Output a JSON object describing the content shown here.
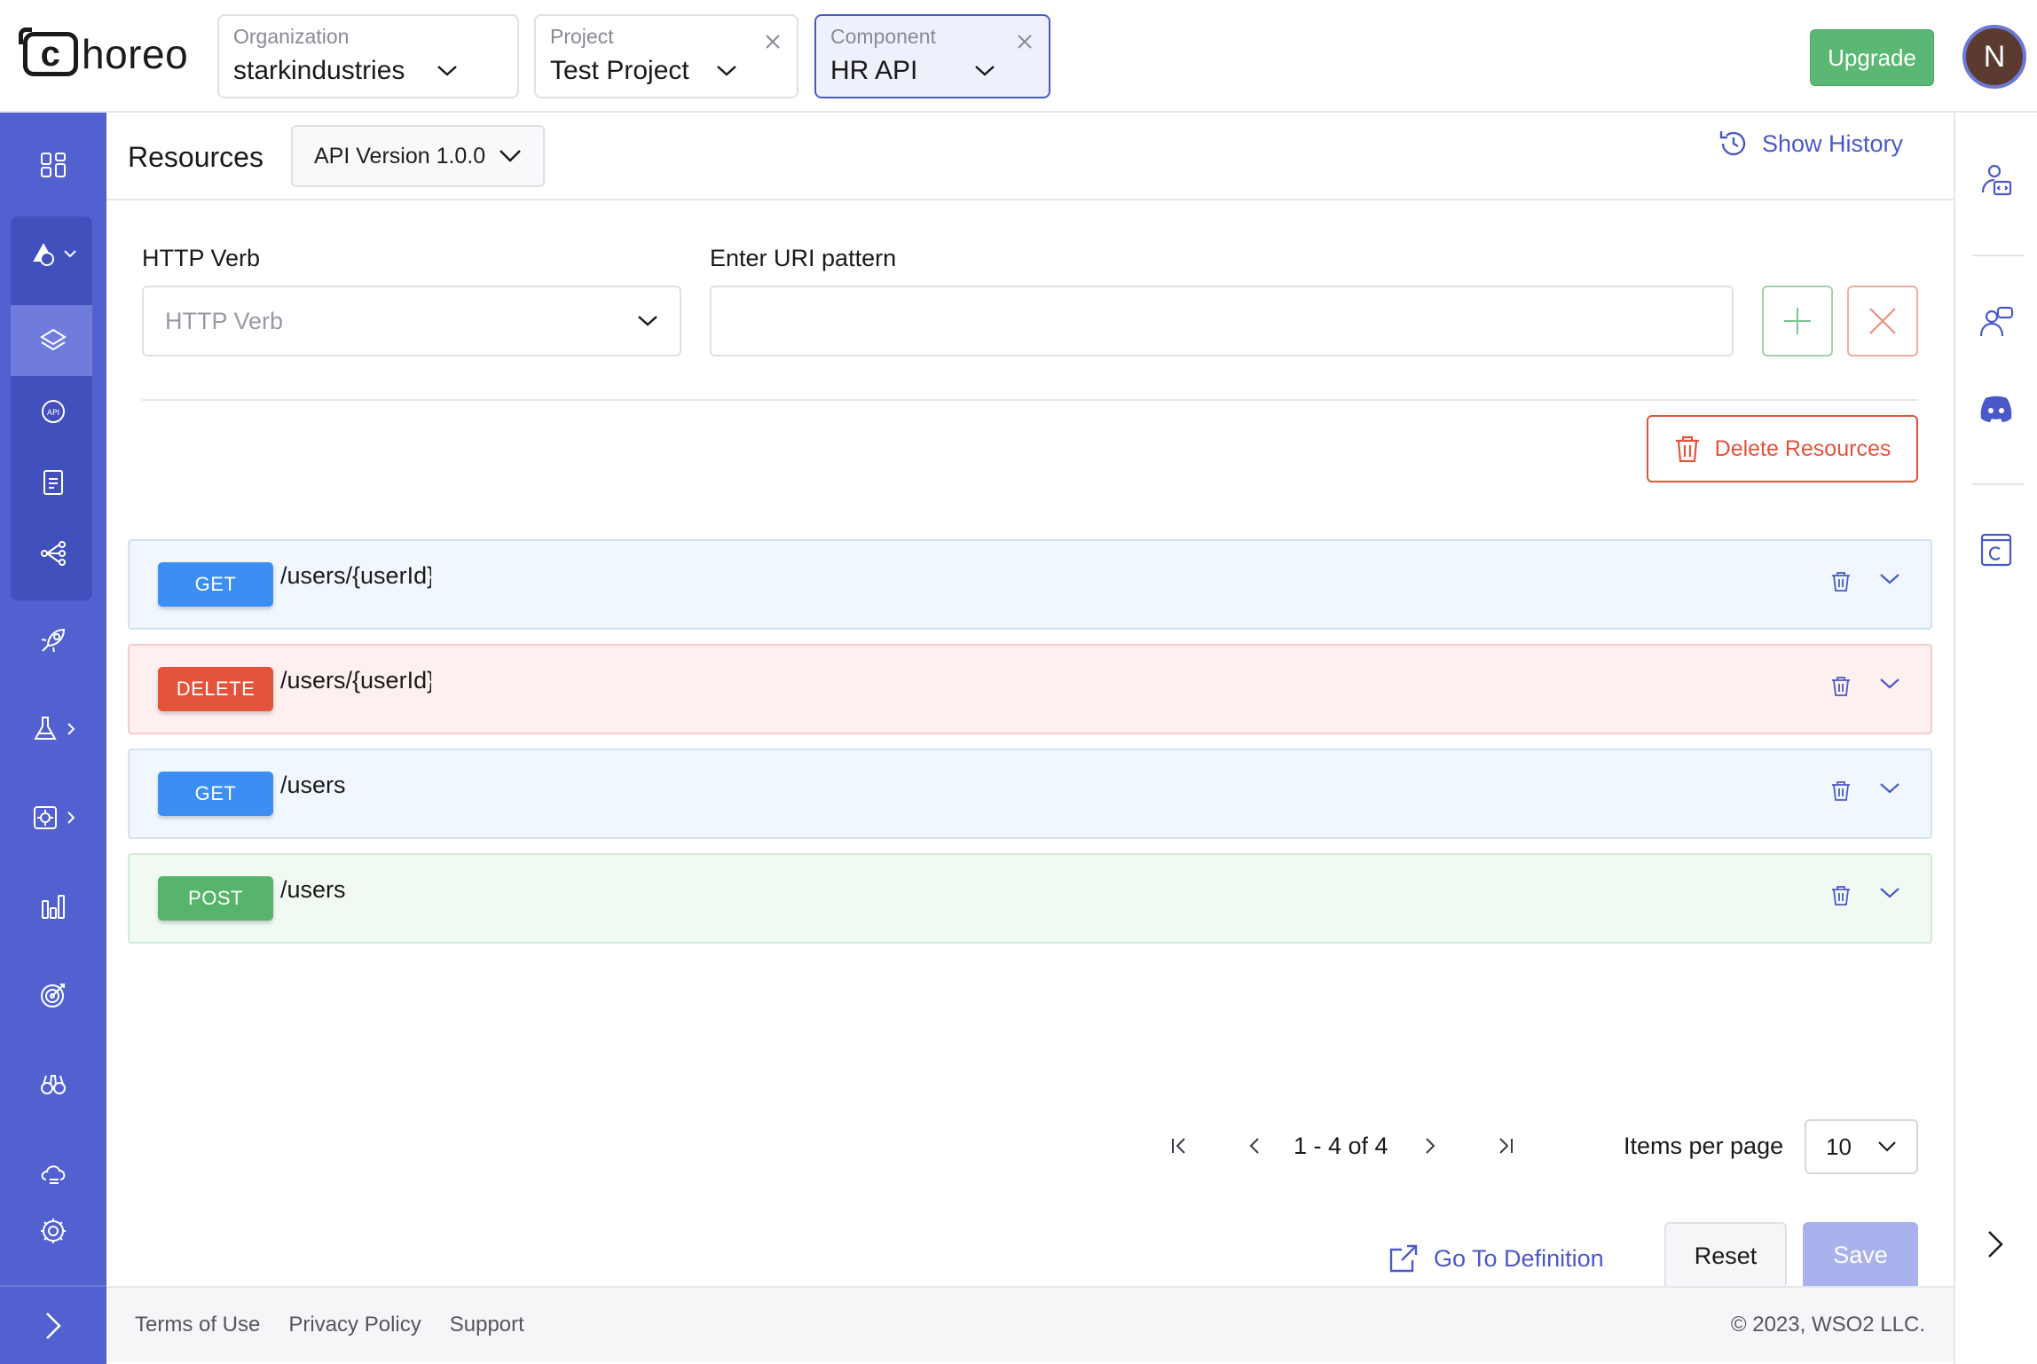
{
  "header": {
    "logo_text": "horeo",
    "logo_letter": "c",
    "organization": {
      "label": "Organization",
      "value": "starkindustries"
    },
    "project": {
      "label": "Project",
      "value": "Test Project"
    },
    "component": {
      "label": "Component",
      "value": "HR API"
    },
    "upgrade_label": "Upgrade",
    "avatar_initial": "N"
  },
  "sidebar": {
    "items": [
      {
        "icon": "overview-grid-icon"
      },
      {
        "icon": "develop-icon"
      },
      {
        "icon": "layers-icon"
      },
      {
        "icon": "api-icon"
      },
      {
        "icon": "document-icon"
      },
      {
        "icon": "connections-icon"
      },
      {
        "icon": "deploy-rocket-icon"
      },
      {
        "icon": "test-flask-icon"
      },
      {
        "icon": "manage-gear-icon"
      },
      {
        "icon": "analytics-bars-icon"
      },
      {
        "icon": "observe-target-icon"
      },
      {
        "icon": "insights-binoculars-icon"
      },
      {
        "icon": "cloud-icon"
      },
      {
        "icon": "settings-icon"
      }
    ],
    "expand_icon": "chevron-right-icon"
  },
  "subheader": {
    "title": "Resources",
    "version_select": "API Version 1.0.0",
    "history_label": "Show History"
  },
  "form": {
    "verb_label": "HTTP Verb",
    "verb_placeholder": "HTTP Verb",
    "uri_label": "Enter URI pattern",
    "uri_value": "",
    "delete_resources_label": "Delete Resources"
  },
  "resources": [
    {
      "method": "GET",
      "path": "/users/{userId}"
    },
    {
      "method": "DELETE",
      "path": "/users/{userId}"
    },
    {
      "method": "GET",
      "path": "/users"
    },
    {
      "method": "POST",
      "path": "/users"
    }
  ],
  "pagination": {
    "range_label": "1 - 4 of 4",
    "items_per_page_label": "Items per page",
    "items_per_page_value": "10"
  },
  "actions": {
    "go_to_definition": "Go To Definition",
    "reset": "Reset",
    "save": "Save"
  },
  "footer": {
    "links": [
      "Terms of Use",
      "Privacy Policy",
      "Support"
    ],
    "copyright": "© 2023, WSO2 LLC."
  },
  "colors": {
    "sidebar": "#5261cf",
    "accent": "#4b59c8",
    "get": "#3d8ef2",
    "delete": "#e6533c",
    "post": "#57b46c",
    "upgrade": "#5bb872"
  }
}
